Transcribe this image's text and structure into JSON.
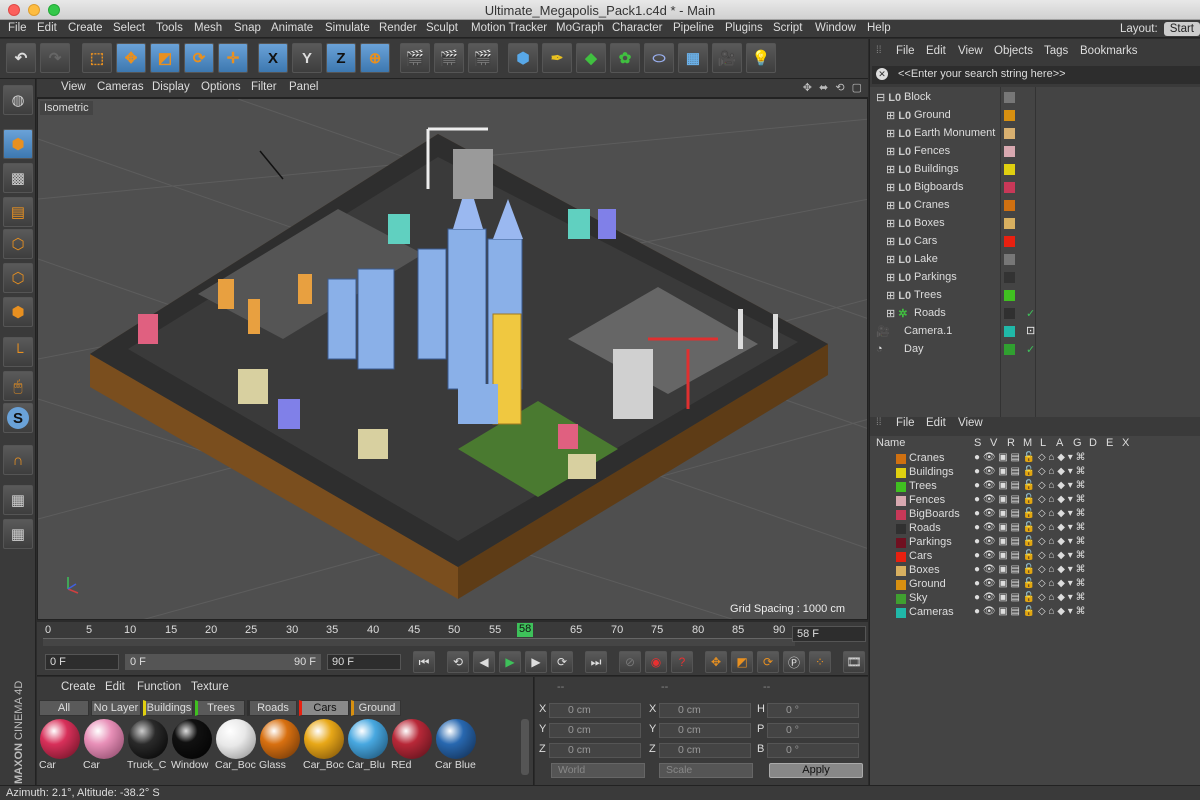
{
  "window": {
    "title": "Ultimate_Megapolis_Pack1.c4d * - Main"
  },
  "menu": [
    "File",
    "Edit",
    "Create",
    "Select",
    "Tools",
    "Mesh",
    "Snap",
    "Animate",
    "Simulate",
    "Render",
    "Sculpt",
    "Motion Tracker",
    "MoGraph",
    "Character",
    "Pipeline",
    "Plugins",
    "Script",
    "Window",
    "Help"
  ],
  "layout": {
    "label": "Layout:",
    "value": "Start"
  },
  "toolbar": {
    "x_label": "X",
    "y_label": "Y",
    "z_label": "Z"
  },
  "viewport": {
    "menu": [
      "View",
      "Cameras",
      "Display",
      "Options",
      "Filter",
      "Panel"
    ],
    "label": "Isometric",
    "grid_spacing": "Grid Spacing : 1000 cm"
  },
  "timeline": {
    "ticks": [
      "0",
      "5",
      "10",
      "15",
      "20",
      "25",
      "30",
      "35",
      "40",
      "45",
      "50",
      "55",
      "58",
      "65",
      "70",
      "75",
      "80",
      "85",
      "90"
    ],
    "current_frame": "58",
    "current_field": "58 F",
    "start": "0 F",
    "range_start": "0 F",
    "range_end": "90 F",
    "end": "90 F"
  },
  "materials": {
    "menu": [
      "Create",
      "Edit",
      "Function",
      "Texture"
    ],
    "tabs": [
      "All",
      "No Layer",
      "Buildings",
      "Trees",
      "Roads",
      "Cars",
      "Ground"
    ],
    "active_tab": "Cars",
    "items": [
      {
        "name": "Car",
        "color": "#d8305a"
      },
      {
        "name": "Car",
        "color": "#e890b8"
      },
      {
        "name": "Truck_C",
        "color": "#2a2a2a"
      },
      {
        "name": "Window",
        "color": "#111111"
      },
      {
        "name": "Car_Boc",
        "color": "#e8e8e8"
      },
      {
        "name": "Glass",
        "color": "#d87010"
      },
      {
        "name": "Car_Boc",
        "color": "#e8a818"
      },
      {
        "name": "Car_Blu",
        "color": "#48a8e0"
      },
      {
        "name": "REd",
        "color": "#b82838"
      },
      {
        "name": "Car Blue",
        "color": "#2868b0"
      }
    ]
  },
  "coords": {
    "headers": [
      "--",
      "--",
      "--"
    ],
    "rows": [
      {
        "a": "X",
        "av": "0 cm",
        "b": "X",
        "bv": "0 cm",
        "c": "H",
        "cv": "0 °"
      },
      {
        "a": "Y",
        "av": "0 cm",
        "b": "Y",
        "bv": "0 cm",
        "c": "P",
        "cv": "0 °"
      },
      {
        "a": "Z",
        "av": "0 cm",
        "b": "Z",
        "bv": "0 cm",
        "c": "B",
        "cv": "0 °"
      }
    ],
    "mode1": "World",
    "mode2": "Scale",
    "apply": "Apply"
  },
  "status": "Azimuth: 2.1°, Altitude: -38.2°  S",
  "brand": {
    "maxon": "MAXON",
    "product": "CINEMA 4D"
  },
  "objects": {
    "menu": [
      "File",
      "Edit",
      "View",
      "Objects",
      "Tags",
      "Bookmarks"
    ],
    "search_placeholder": "<<Enter your search string here>>",
    "items": [
      {
        "name": "Block",
        "color": "#777777",
        "indent": 0
      },
      {
        "name": "Ground",
        "color": "#d89010",
        "indent": 1
      },
      {
        "name": "Earth Monument",
        "color": "#d8b070",
        "indent": 1
      },
      {
        "name": "Fences",
        "color": "#d8a8b0",
        "indent": 1
      },
      {
        "name": "Buildings",
        "color": "#e0d010",
        "indent": 1
      },
      {
        "name": "Bigboards",
        "color": "#c83858",
        "indent": 1
      },
      {
        "name": "Cranes",
        "color": "#d07010",
        "indent": 1
      },
      {
        "name": "Boxes",
        "color": "#d8b060",
        "indent": 1
      },
      {
        "name": "Cars",
        "color": "#e82010",
        "indent": 1
      },
      {
        "name": "Lake",
        "color": "#777777",
        "indent": 1
      },
      {
        "name": "Parkings",
        "color": "#333333",
        "indent": 1
      },
      {
        "name": "Trees",
        "color": "#40c020",
        "indent": 1
      },
      {
        "name": "Roads",
        "color": "#303030",
        "indent": 1
      },
      {
        "name": "Camera.1",
        "color": "#20b8a8",
        "indent": 0
      },
      {
        "name": "Day",
        "color": "#30a030",
        "indent": 0
      }
    ]
  },
  "layers": {
    "menu": [
      "File",
      "Edit",
      "View"
    ],
    "headers": [
      "Name",
      "S",
      "V",
      "R",
      "M",
      "L",
      "A",
      "G",
      "D",
      "E",
      "X"
    ],
    "items": [
      {
        "name": "Cranes",
        "color": "#d07010"
      },
      {
        "name": "Buildings",
        "color": "#e0d010"
      },
      {
        "name": "Trees",
        "color": "#40c020"
      },
      {
        "name": "Fences",
        "color": "#d8a8b0"
      },
      {
        "name": "BigBoards",
        "color": "#c83858"
      },
      {
        "name": "Roads",
        "color": "#303030"
      },
      {
        "name": "Parkings",
        "color": "#701020"
      },
      {
        "name": "Cars",
        "color": "#e82010"
      },
      {
        "name": "Boxes",
        "color": "#d8b060"
      },
      {
        "name": "Ground",
        "color": "#d89010"
      },
      {
        "name": "Sky",
        "color": "#40a030"
      },
      {
        "name": "Cameras",
        "color": "#20b8a8"
      }
    ]
  }
}
